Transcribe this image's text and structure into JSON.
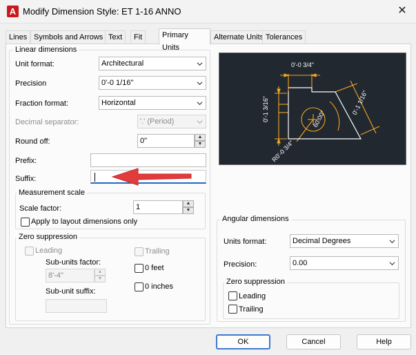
{
  "window": {
    "title": "Modify Dimension Style: ET 1-16 ANNO",
    "app_letter": "A"
  },
  "tabs": [
    "Lines",
    "Symbols and Arrows",
    "Text",
    "Fit",
    "Primary Units",
    "Alternate Units",
    "Tolerances"
  ],
  "linear": {
    "title": "Linear dimensions",
    "unit_format_label": "Unit format:",
    "unit_format_value": "Architectural",
    "precision_label": "Precision",
    "precision_value": "0'-0 1/16\"",
    "fraction_label": "Fraction format:",
    "fraction_value": "Horizontal",
    "decimal_label": "Decimal separator:",
    "decimal_value": "'.' (Period)",
    "roundoff_label": "Round off:",
    "roundoff_value": "0\"",
    "prefix_label": "Prefix:",
    "prefix_value": "",
    "suffix_label": "Suffix:",
    "suffix_value": ""
  },
  "measurement": {
    "title": "Measurement scale",
    "scale_label": "Scale factor:",
    "scale_value": "1",
    "apply_label": "Apply to layout dimensions only"
  },
  "zero": {
    "title": "Zero suppression",
    "leading": "Leading",
    "trailing": "Trailing",
    "subunits_label": "Sub-units factor:",
    "subunits_value": "8'-4\"",
    "subunit_suffix_label": "Sub-unit suffix:",
    "feet": "0 feet",
    "inches": "0 inches"
  },
  "angular": {
    "title": "Angular dimensions",
    "units_label": "Units format:",
    "units_value": "Decimal Degrees",
    "precision_label": "Precision:",
    "precision_value": "0.00",
    "zero_title": "Zero suppression",
    "leading": "Leading",
    "trailing": "Trailing"
  },
  "preview": {
    "dim_top": "0'-0 3/4\"",
    "dim_left": "0'-1 3/16\"",
    "dim_right": "0'-1 1/16\"",
    "dim_bottom": "R0'-0 3/4\"",
    "dim_angle": "60.00°",
    "colors": {
      "background": "#212830",
      "geometry": "#ffffff",
      "dimension": "#f5a623",
      "text": "#ffffff"
    }
  },
  "buttons": {
    "ok": "OK",
    "cancel": "Cancel",
    "help": "Help"
  },
  "annotation": {
    "arrow_color": "#e23b3b"
  }
}
